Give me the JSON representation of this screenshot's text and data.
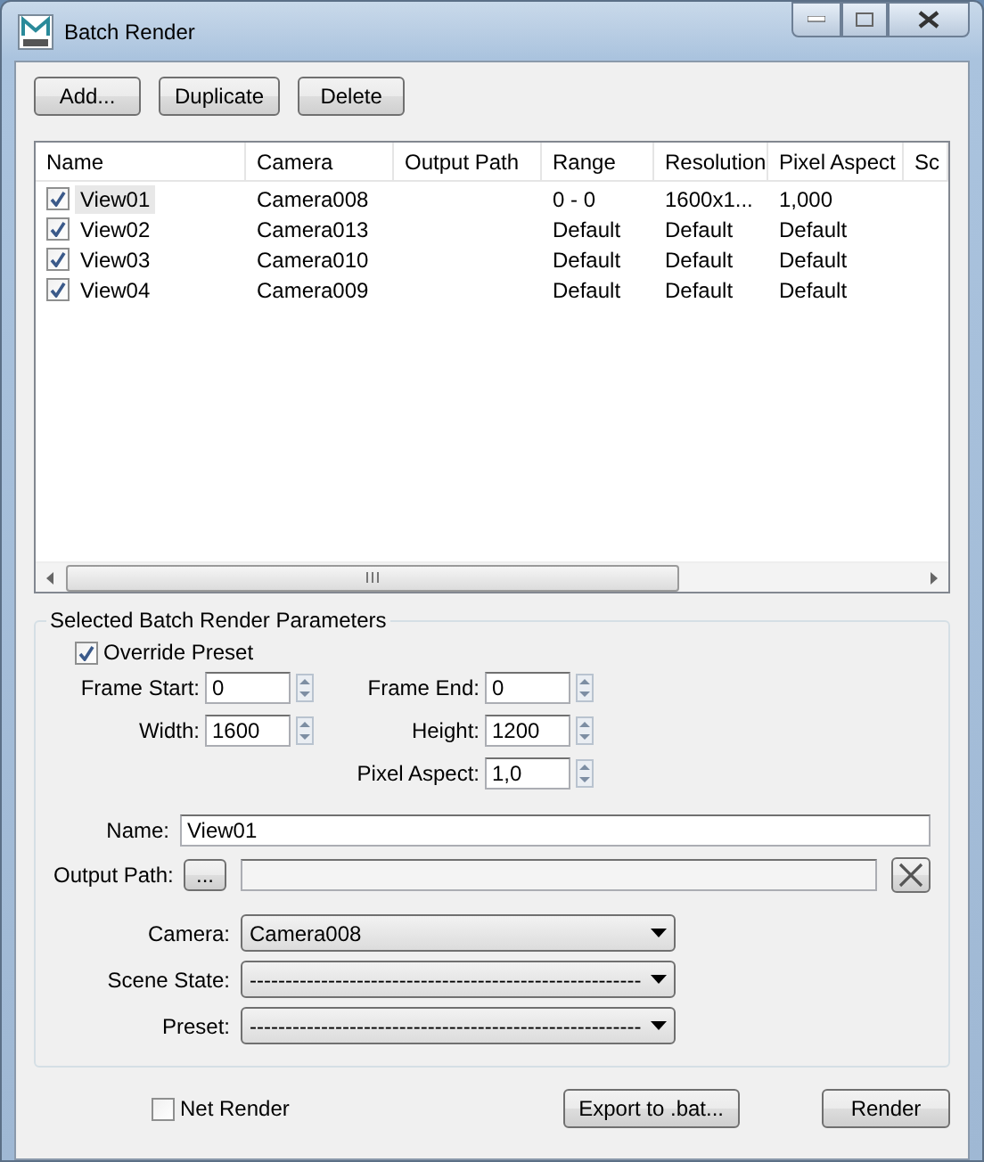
{
  "window": {
    "title": "Batch Render"
  },
  "toolbar": [
    "Add...",
    "Duplicate",
    "Delete"
  ],
  "table": {
    "columns": [
      "Name",
      "Camera",
      "Output Path",
      "Range",
      "Resolution",
      "Pixel Aspect",
      "Sc"
    ],
    "rows": [
      {
        "name": "View01",
        "checked": true,
        "selected": true,
        "camera": "Camera008",
        "range": "0 - 0",
        "resolution": "1600x1...",
        "pixel_aspect": "1,000"
      },
      {
        "name": "View02",
        "checked": true,
        "selected": false,
        "camera": "Camera013",
        "range": "Default",
        "resolution": "Default",
        "pixel_aspect": "Default"
      },
      {
        "name": "View03",
        "checked": true,
        "selected": false,
        "camera": "Camera010",
        "range": "Default",
        "resolution": "Default",
        "pixel_aspect": "Default"
      },
      {
        "name": "View04",
        "checked": true,
        "selected": false,
        "camera": "Camera009",
        "range": "Default",
        "resolution": "Default",
        "pixel_aspect": "Default"
      }
    ]
  },
  "parameters": {
    "title": "Selected Batch Render Parameters",
    "override_preset": {
      "label": "Override Preset",
      "checked": true
    },
    "spinner_rows": [
      {
        "left": {
          "label": "Frame Start:",
          "value": "0"
        },
        "right": {
          "label": "Frame End:",
          "value": "0"
        }
      },
      {
        "left": {
          "label": "Width:",
          "value": "1600"
        },
        "right": {
          "label": "Height:",
          "value": "1200"
        }
      },
      {
        "right": {
          "label": "Pixel Aspect:",
          "value": "1,0"
        }
      }
    ],
    "name": {
      "label": "Name:",
      "value": "View01"
    },
    "output_path": {
      "label": "Output Path:",
      "button": "..."
    },
    "dropdowns": [
      {
        "label": "Camera:",
        "value": "Camera008"
      },
      {
        "label": "Scene State:",
        "value": "-------------------------------------------------------"
      },
      {
        "label": "Preset:",
        "value": "-------------------------------------------------------"
      }
    ]
  },
  "footer": {
    "net_render": {
      "label": "Net Render",
      "checked": false
    },
    "buttons": [
      "Export to .bat...",
      "Render"
    ]
  }
}
